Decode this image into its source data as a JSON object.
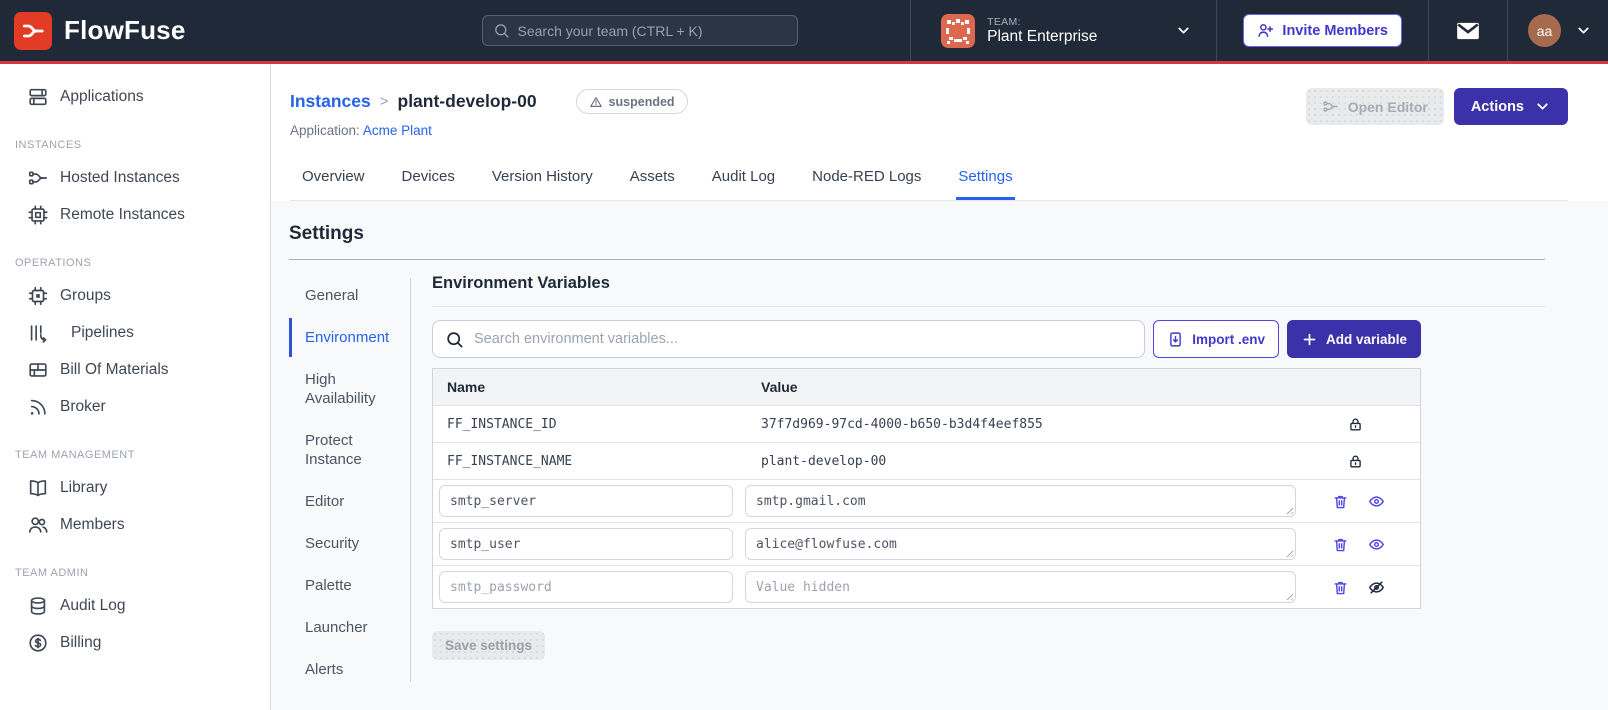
{
  "navbar": {
    "brand": "FlowFuse",
    "search_placeholder": "Search your team (CTRL + K)",
    "team_label": "TEAM:",
    "team_name": "Plant Enterprise",
    "invite_button": "Invite Members",
    "avatar_initials": "aa"
  },
  "sidebar": {
    "item_applications": "Applications",
    "section_instances": "INSTANCES",
    "item_hosted": "Hosted Instances",
    "item_remote": "Remote Instances",
    "section_operations": "OPERATIONS",
    "item_groups": "Groups",
    "item_pipelines": "Pipelines",
    "item_bom": "Bill Of Materials",
    "item_broker": "Broker",
    "section_team_management": "TEAM MANAGEMENT",
    "item_library": "Library",
    "item_members": "Members",
    "section_team_admin": "TEAM ADMIN",
    "item_audit_log": "Audit Log",
    "item_billing": "Billing"
  },
  "header": {
    "breadcrumb_root": "Instances",
    "breadcrumb_separator": ">",
    "instance_name": "plant-develop-00",
    "status_badge": "suspended",
    "application_label": "Application:",
    "application_name": "Acme Plant",
    "open_editor_button": "Open Editor",
    "actions_button": "Actions"
  },
  "tabs": {
    "items": [
      "Overview",
      "Devices",
      "Version History",
      "Assets",
      "Audit Log",
      "Node-RED Logs",
      "Settings"
    ],
    "active": "Settings"
  },
  "settings": {
    "title": "Settings",
    "nav": [
      "General",
      "Environment",
      "High Availability",
      "Protect Instance",
      "Editor",
      "Security",
      "Palette",
      "Launcher",
      "Alerts"
    ],
    "active": "Environment"
  },
  "env": {
    "title": "Environment Variables",
    "search_placeholder": "Search environment variables...",
    "import_button": "Import .env",
    "add_button": "Add variable",
    "columns": {
      "name": "Name",
      "value": "Value"
    },
    "locked_rows": [
      {
        "name": "FF_INSTANCE_ID",
        "value": "37f7d969-97cd-4000-b650-b3d4f4eef855"
      },
      {
        "name": "FF_INSTANCE_NAME",
        "value": "plant-develop-00"
      }
    ],
    "editable_rows": [
      {
        "name": "smtp_server",
        "value": "smtp.gmail.com",
        "hidden": false
      },
      {
        "name": "smtp_user",
        "value": "alice@flowfuse.com",
        "hidden": false
      },
      {
        "name": "smtp_password",
        "value": "",
        "value_placeholder": "Value hidden",
        "hidden": true
      }
    ],
    "save_button": "Save settings"
  },
  "colors": {
    "navbar_bg": "#1f2937",
    "accent_red_line": "#d6373e",
    "brand_red": "#e23b26",
    "primary_indigo": "#3b31a8",
    "outline_indigo": "#4f46e5",
    "link_blue": "#2563eb",
    "team_avatar_orange": "#dd6850",
    "user_avatar_brown": "#a66a4e"
  }
}
